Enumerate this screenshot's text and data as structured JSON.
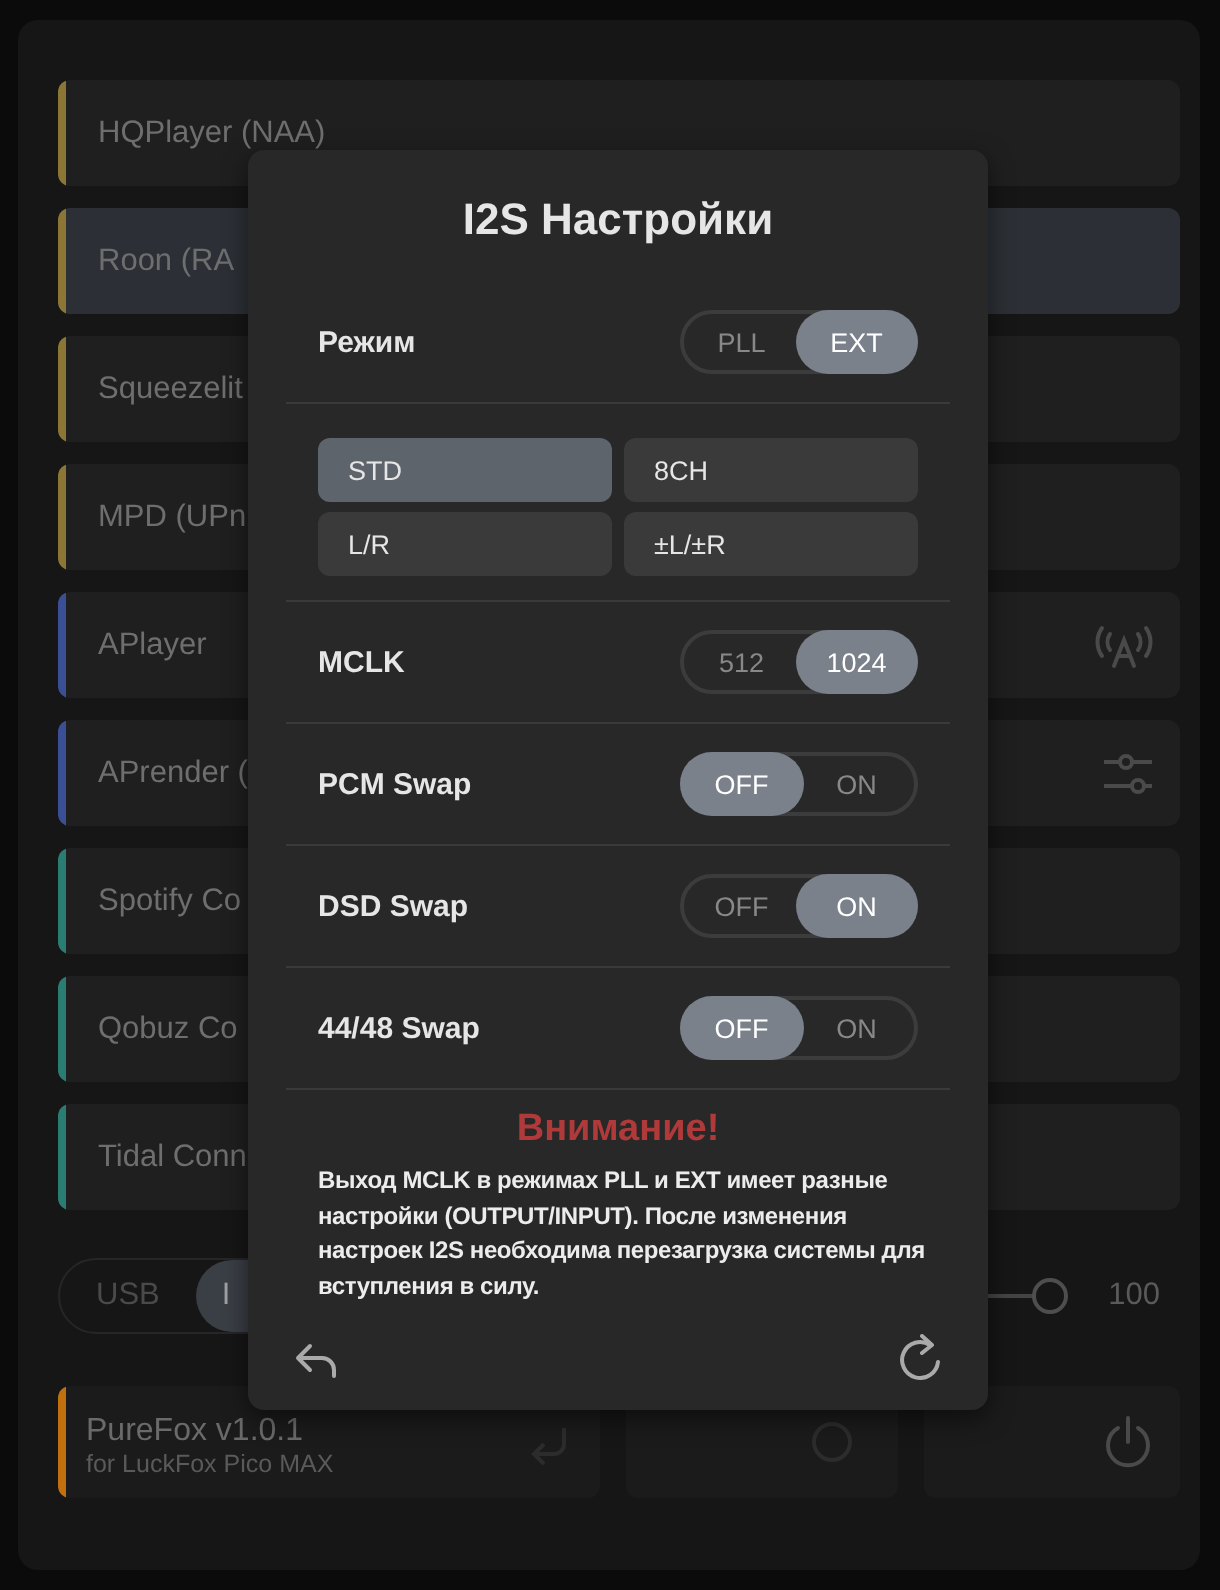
{
  "services": [
    {
      "name": "HQPlayer (NAA)",
      "color": "#8c7636",
      "selected": false
    },
    {
      "name": "Roon (RA",
      "color": "#8c7636",
      "selected": true
    },
    {
      "name": "Squeezelit",
      "color": "#8c7636",
      "selected": false
    },
    {
      "name": "MPD (UPn",
      "color": "#8c7636",
      "selected": false
    },
    {
      "name": "APlayer",
      "color": "#3b4f96",
      "selected": false
    },
    {
      "name": "APrender (",
      "color": "#3b4f96",
      "selected": false
    },
    {
      "name": "Spotify Co",
      "color": "#2a7d72",
      "selected": false
    },
    {
      "name": "Qobuz Co",
      "color": "#2a7d72",
      "selected": false
    },
    {
      "name": "Tidal Conn",
      "color": "#2a7d72",
      "selected": false
    }
  ],
  "output": [
    {
      "label": "USB",
      "selected": false
    },
    {
      "label": "I",
      "selected": true
    }
  ],
  "volume": {
    "level": 1,
    "reading": "100"
  },
  "device": {
    "name": "PureFox v1.0.1",
    "subtitle": "for LuckFox Pico MAX",
    "color": "#c2700f"
  },
  "dialog": {
    "title": "I2S Настройки",
    "rows": [
      {
        "kind": "toggle",
        "label": "Режим",
        "options": [
          {
            "label": "PLL",
            "selected": false
          },
          {
            "label": "EXT",
            "selected": true
          }
        ]
      },
      {
        "kind": "grid",
        "options": [
          {
            "label": "STD",
            "selected": true
          },
          {
            "label": "8CH",
            "selected": false
          },
          {
            "label": "L/R",
            "selected": false
          },
          {
            "label": "±L/±R",
            "selected": false
          }
        ]
      },
      {
        "kind": "toggle",
        "label": "MCLK",
        "options": [
          {
            "label": "512",
            "selected": false
          },
          {
            "label": "1024",
            "selected": true
          }
        ]
      },
      {
        "kind": "toggle",
        "label": "PCM Swap",
        "options": [
          {
            "label": "OFF",
            "selected": true
          },
          {
            "label": "ON",
            "selected": false
          }
        ]
      },
      {
        "kind": "toggle",
        "label": "DSD Swap",
        "options": [
          {
            "label": "OFF",
            "selected": false
          },
          {
            "label": "ON",
            "selected": true
          }
        ]
      },
      {
        "kind": "toggle",
        "label": "44/48 Swap",
        "options": [
          {
            "label": "OFF",
            "selected": true
          },
          {
            "label": "ON",
            "selected": false
          }
        ]
      }
    ],
    "warning_title": "Внимание!",
    "warning_text": "Выход MCLK в режимах PLL и EXT имеет разные настройки (OUTPUT/INPUT). После изменения настроек I2S необходима перезагрузка системы для вступления в силу."
  }
}
